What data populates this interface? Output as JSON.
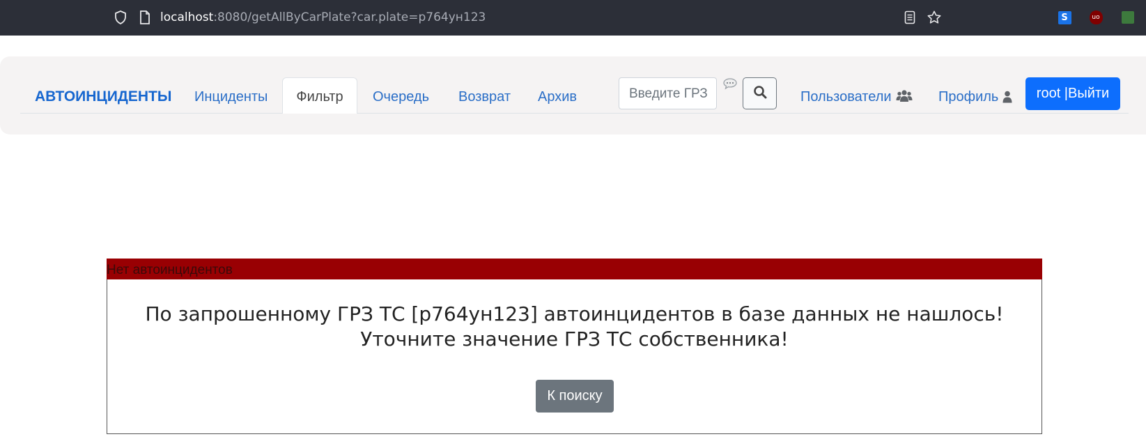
{
  "browser": {
    "url_host": "localhost",
    "url_rest": ":8080/getAllByCarPlate?car.plate=р764ун123",
    "ext_s_label": "S",
    "ext_ub_label": "uo"
  },
  "navbar": {
    "brand": "АВТОИНЦИДЕНТЫ",
    "links": {
      "incidents": "Инциденты",
      "filter": "Фильтр",
      "queue": "Очередь",
      "return": "Возврат",
      "archive": "Архив"
    },
    "search_placeholder": "Введите ГРЗ",
    "users": "Пользователи",
    "profile": "Профиль",
    "logout": "root |Выйти"
  },
  "content": {
    "header": "Нет автоинцидентов",
    "message_line1": "По запрошенному ГРЗ ТС [р764ун123] автоинцидентов в базе данных не нашлось!",
    "message_line2": "Уточните значение ГРЗ ТС собственника!",
    "back_button": "К поиску"
  },
  "colors": {
    "browser_bar": "#2c2f38",
    "navbar_bg": "#f5f3f3",
    "brand": "#1666cf",
    "primary_button": "#0d6efd",
    "alert_header": "#990003",
    "secondary_button": "#6c757d"
  },
  "icons": [
    "shield-icon",
    "page-icon",
    "reader-icon",
    "star-icon",
    "chat-icon",
    "search-icon",
    "users-icon",
    "user-icon"
  ]
}
